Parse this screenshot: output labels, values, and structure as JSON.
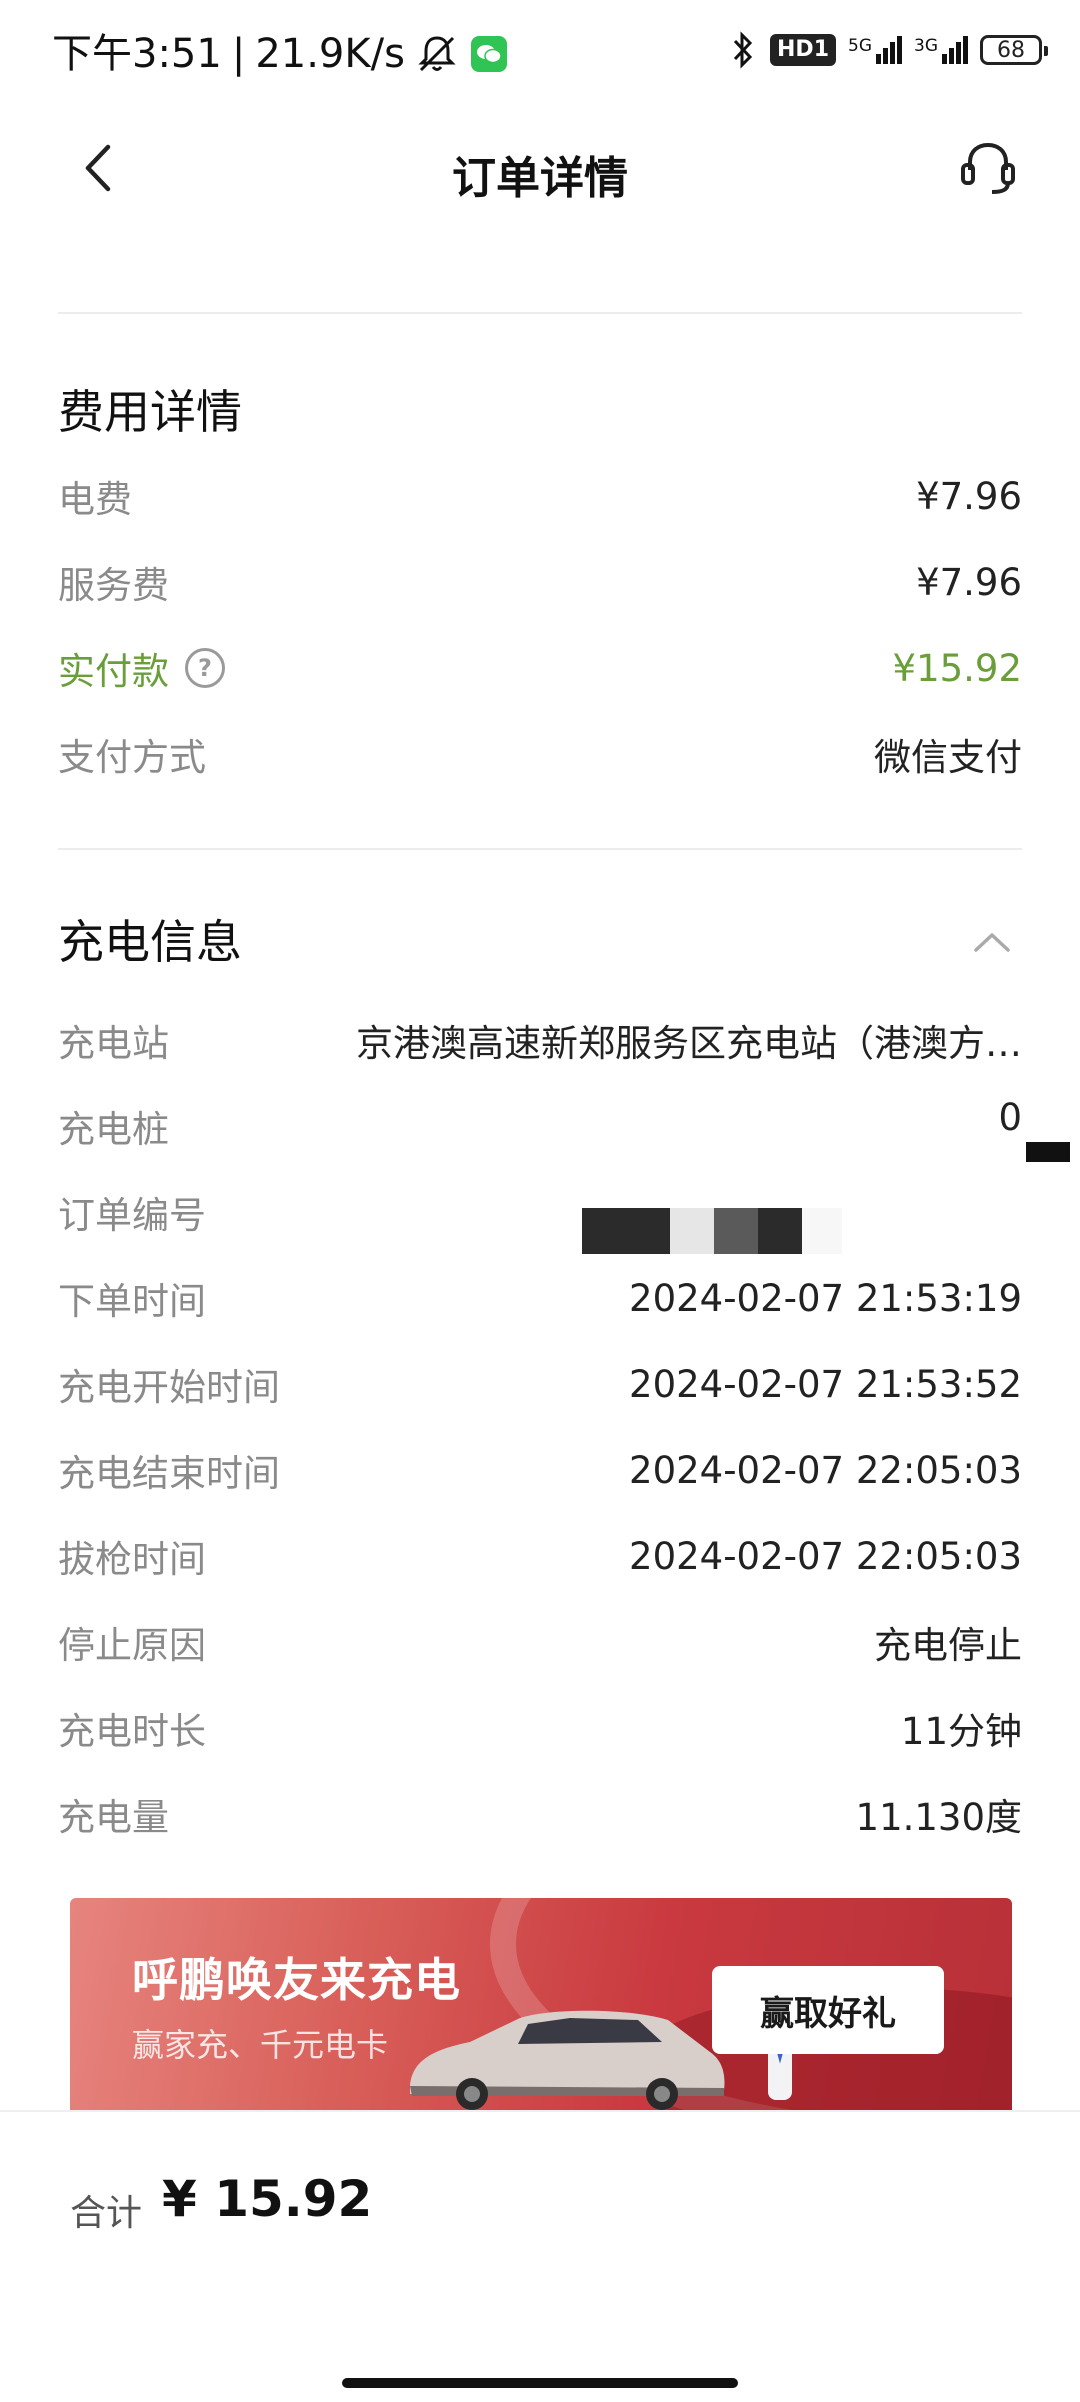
{
  "status_bar": {
    "time": "下午3:51",
    "speed": "21.9K/s",
    "hd_label": "HD1",
    "network1": "5G",
    "network2": "3G",
    "battery": "68"
  },
  "nav": {
    "title": "订单详情"
  },
  "fees": {
    "title": "费用详情",
    "rows": [
      {
        "label": "电费",
        "value": "¥7.96"
      },
      {
        "label": "服务费",
        "value": "¥7.96"
      },
      {
        "label": "实付款",
        "value": "¥15.92"
      },
      {
        "label": "支付方式",
        "value": "微信支付"
      }
    ]
  },
  "charging": {
    "title": "充电信息",
    "rows": [
      {
        "label": "充电站",
        "value": "京港澳高速新郑服务区充电站（港澳方…"
      },
      {
        "label": "充电桩",
        "value": "0"
      },
      {
        "label": "订单编号",
        "value": ""
      },
      {
        "label": "下单时间",
        "value": "2024-02-07 21:53:19"
      },
      {
        "label": "充电开始时间",
        "value": "2024-02-07 21:53:52"
      },
      {
        "label": "充电结束时间",
        "value": "2024-02-07 22:05:03"
      },
      {
        "label": "拔枪时间",
        "value": "2024-02-07 22:05:03"
      },
      {
        "label": "停止原因",
        "value": "充电停止"
      },
      {
        "label": "充电时长",
        "value": "11分钟"
      },
      {
        "label": "充电量",
        "value": "11.130度"
      }
    ]
  },
  "banner": {
    "title": "呼鹏唤友来充电",
    "subtitle": "赢家充、千元电卡",
    "button": "赢取好礼"
  },
  "footer": {
    "total_label": "合计",
    "total_value": "¥ 15.92"
  },
  "colors": {
    "accent_green": "#6a9e3a",
    "banner_red": "#c9393f"
  }
}
